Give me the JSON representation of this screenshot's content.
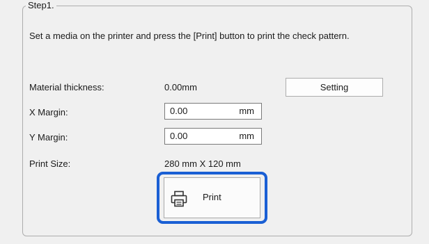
{
  "group": {
    "title": "Step1."
  },
  "instruction": "Set a media on the printer and press the [Print] button to print the check pattern.",
  "material_thickness": {
    "label": "Material thickness:",
    "value": "0.00mm",
    "button_label": "Setting"
  },
  "x_margin": {
    "label": "X Margin:",
    "value": "0.00",
    "unit": "mm"
  },
  "y_margin": {
    "label": "Y Margin:",
    "value": "0.00",
    "unit": "mm"
  },
  "print_size": {
    "label": "Print Size:",
    "value": "280 mm X 120 mm"
  },
  "print_button": {
    "label": "Print",
    "icon": "printer-icon",
    "focused": true
  },
  "colors": {
    "background": "#f0f0f0",
    "focus_ring": "#1a5fd4",
    "border": "#adadad"
  }
}
